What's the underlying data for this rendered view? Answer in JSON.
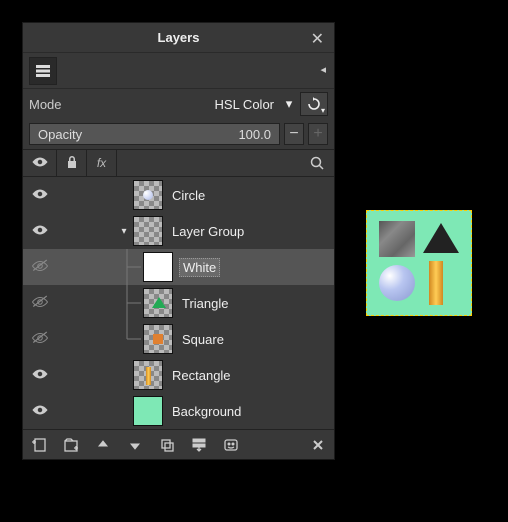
{
  "panel": {
    "title": "Layers"
  },
  "mode": {
    "label": "Mode",
    "value": "HSL Color"
  },
  "opacity": {
    "label": "Opacity",
    "value": "100.0"
  },
  "header": {
    "fx": "fx"
  },
  "layers": [
    {
      "name": "Circle",
      "visible": true,
      "depth": 0,
      "thumb": "circle",
      "expander": null
    },
    {
      "name": "Layer Group",
      "visible": true,
      "depth": 0,
      "thumb": "checker",
      "expander": "open"
    },
    {
      "name": "White",
      "visible": false,
      "depth": 1,
      "thumb": "white",
      "expander": null,
      "selected": true
    },
    {
      "name": "Triangle",
      "visible": false,
      "depth": 1,
      "thumb": "triangle",
      "expander": null
    },
    {
      "name": "Square",
      "visible": false,
      "depth": 1,
      "thumb": "square",
      "expander": null
    },
    {
      "name": "Rectangle",
      "visible": true,
      "depth": 0,
      "thumb": "rect",
      "expander": null
    },
    {
      "name": "Background",
      "visible": true,
      "depth": 0,
      "thumb": "bg",
      "expander": null
    }
  ],
  "toolbar_icons": [
    "new-layer",
    "new-group",
    "raise",
    "lower",
    "duplicate",
    "merge",
    "mask",
    "delete"
  ]
}
